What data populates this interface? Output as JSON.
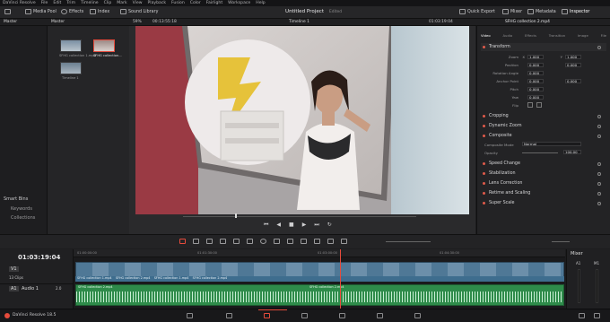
{
  "app": {
    "menu": [
      "DaVinci Resolve",
      "File",
      "Edit",
      "Trim",
      "Timeline",
      "Clip",
      "Mark",
      "View",
      "Playback",
      "Fusion",
      "Color",
      "Fairlight",
      "Workspace",
      "Help"
    ]
  },
  "toolbar": {
    "media_pool": "Media Pool",
    "effects": "Effects",
    "index": "Index",
    "sound_library": "Sound Library",
    "project_title": "Untitled Project",
    "edited": "Edited",
    "quick_export": "Quick Export",
    "mixer": "Mixer",
    "metadata": "Metadata",
    "inspector": "Inspector"
  },
  "subbar": {
    "zoom": "59%",
    "timecode": "00:13:55:18",
    "timeline": "Timeline 1",
    "right_timecode": "01:03:19:04",
    "clip_name": "SFHG collection 2.mp4"
  },
  "bins": {
    "master_header": "Master",
    "pool_header": "Master",
    "smart_bins": "Smart Bins",
    "keywords": "Keywords",
    "collections": "Collections",
    "clips": [
      {
        "name": "SFHG collection 1.mp4"
      },
      {
        "name": "SFHG collection..."
      },
      {
        "name": "Timeline 1"
      }
    ]
  },
  "inspector": {
    "tabs": [
      "Video",
      "Audio",
      "Effects",
      "Transition",
      "Image",
      "File"
    ],
    "sections": [
      "Transform",
      "Cropping",
      "Dynamic Zoom",
      "Composite",
      "Speed Change",
      "Stabilization",
      "Lens Correction",
      "Retime and Scaling",
      "Super Scale"
    ],
    "params": {
      "zoom": "Zoom",
      "zoom_x": "1.000",
      "zoom_y": "1.000",
      "position": "Position",
      "pos_x": "0.000",
      "pos_y": "0.000",
      "rotation": "Rotation Angle",
      "rotation_val": "0.000",
      "anchor": "Anchor Point",
      "anchor_x": "0.000",
      "anchor_y": "0.000",
      "pitch": "Pitch",
      "pitch_val": "0.000",
      "yaw": "Yaw",
      "yaw_val": "0.000",
      "flip": "Flip",
      "x": "X",
      "y": "Y",
      "composite_mode": "Composite Mode",
      "composite_mode_val": "Normal",
      "opacity": "Opacity",
      "opacity_val": "100.00"
    }
  },
  "timeline": {
    "timecode": "01:03:19:04",
    "ruler": [
      "01:00:00:00",
      "01:01:30:00",
      "01:03:00:00",
      "01:04:30:00"
    ],
    "v1_label": "V1",
    "clips_count": "13 Clips",
    "a1_label": "A1",
    "audio_label": "Audio 1",
    "audio_level": "2.0",
    "clip_labels": [
      "SFHG collection 1.mp4",
      "SFHG collection 2.mp4",
      "SFHG collection 1.mp4",
      "SFHG collection 2.mp4",
      "SFHG collection 2.mp4",
      "SFHG collection 2.mp4"
    ]
  },
  "mixer": {
    "title": "Mixer",
    "ch1": "A1",
    "ch2": "M1"
  },
  "footer": {
    "app_name": "DaVinci Resolve 18.5"
  },
  "colors": {
    "accent": "#e64b3c",
    "video_clip": "#3e6d8e",
    "audio_clip": "#2e8b4a"
  }
}
